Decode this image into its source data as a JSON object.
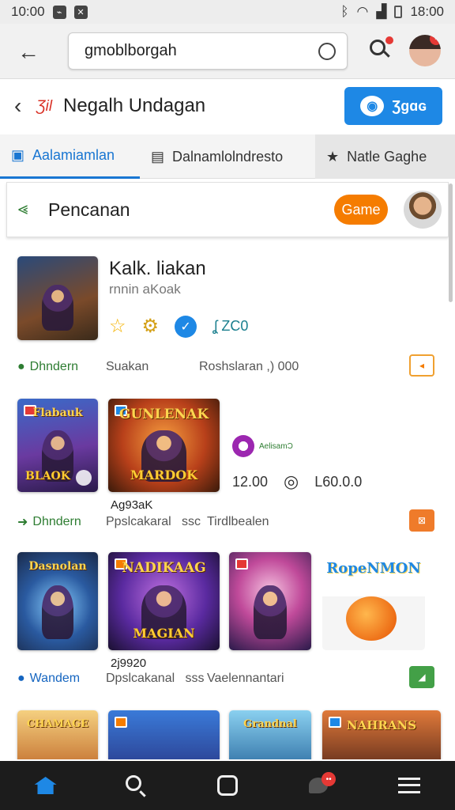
{
  "status_bar": {
    "time": "10:00",
    "time_right": "18:00"
  },
  "search": {
    "value": "gmoblborgah",
    "placeholder": ""
  },
  "header": {
    "title": "Negalh Undagan",
    "brand_mark": "Ʒil",
    "action_label": "Ʒɡɑɢ"
  },
  "tabs": [
    {
      "label": "Aalamiamlan"
    },
    {
      "label": "Dalnamlolndresto"
    },
    {
      "label": "Natle Gaghe"
    }
  ],
  "section": {
    "title": "Pencanan",
    "pill_label": "Game"
  },
  "featured": {
    "name": "Kalk. liakan",
    "subtitle": "rnnin aKoak",
    "count": "ZC0",
    "meta": {
      "download": "Dhndern",
      "col2": "Suakan",
      "col3": "Roshslaran ,) 000"
    }
  },
  "row2": {
    "thumb1_title": "Flabauk",
    "thumb1_bottom": "BLAOK",
    "thumb2_title": "GUNLENAK",
    "thumb2_bottom": "MARDOK",
    "side_label": "AelisamƆ",
    "value_left": "12.00",
    "value_right": "L60.0.0",
    "caption": "Ag93aK",
    "meta": {
      "download": "Dhndern",
      "col2": "Ppslcakaral",
      "col2b": "ssc",
      "col3": "Tirdlbealen"
    }
  },
  "row3": {
    "thumb1_title": "Dasnolan",
    "thumb2_title": "NADIKAAG",
    "thumb2_bottom": "MAGIAN",
    "thumb4_title": "RopeNMON",
    "caption": "2j9920",
    "meta": {
      "download": "Wandem",
      "col2": "Dpslcakanal",
      "col2b": "sss",
      "col3": "Vaelennantari"
    }
  },
  "row4": {
    "thumb1_title": "CHAMAGE",
    "thumb3_title": "Grandnal",
    "thumb4_title": "NAHRANS"
  },
  "colors": {
    "accent": "#1e88e5",
    "orange": "#f57c00",
    "green": "#2e7d32",
    "nav_bg": "#1c1c1c"
  },
  "icons": [
    "back-arrow-icon",
    "search-icon",
    "avatar",
    "chevron-left-icon",
    "star-icon",
    "gear-icon",
    "check-icon",
    "home-icon",
    "menu-icon"
  ]
}
